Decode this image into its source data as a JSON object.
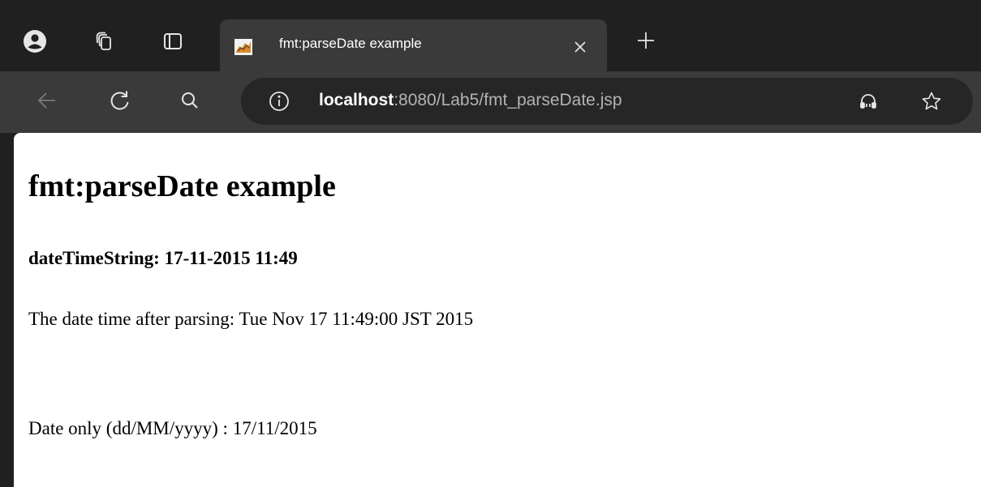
{
  "browser": {
    "tab": {
      "title": "fmt:parseDate example"
    },
    "address_bar": {
      "host": "localhost",
      "path": ":8080/Lab5/fmt_parseDate.jsp"
    },
    "icons": {
      "profile": "profile-icon",
      "workspaces": "workspaces-icon",
      "tab_actions": "tab-actions-icon",
      "favicon": "tomcat-favicon",
      "close": "close-icon",
      "new_tab": "plus-icon",
      "back": "back-arrow-icon",
      "refresh": "refresh-icon",
      "search": "search-icon",
      "site_info": "info-icon",
      "read_aloud": "headphones-icon",
      "favorite": "star-icon"
    },
    "colors": {
      "frame": "#202020",
      "toolbar": "#3a3a3a",
      "omnibox": "#262626",
      "page": "#ffffff"
    }
  },
  "page": {
    "heading": "fmt:parseDate example",
    "date_time_string": "dateTimeString: 17-11-2015 11:49",
    "parsed_line": "The date time after parsing: Tue Nov 17 11:49:00 JST 2015",
    "date_only_line": "Date only (dd/MM/yyyy) : 17/11/2015"
  }
}
